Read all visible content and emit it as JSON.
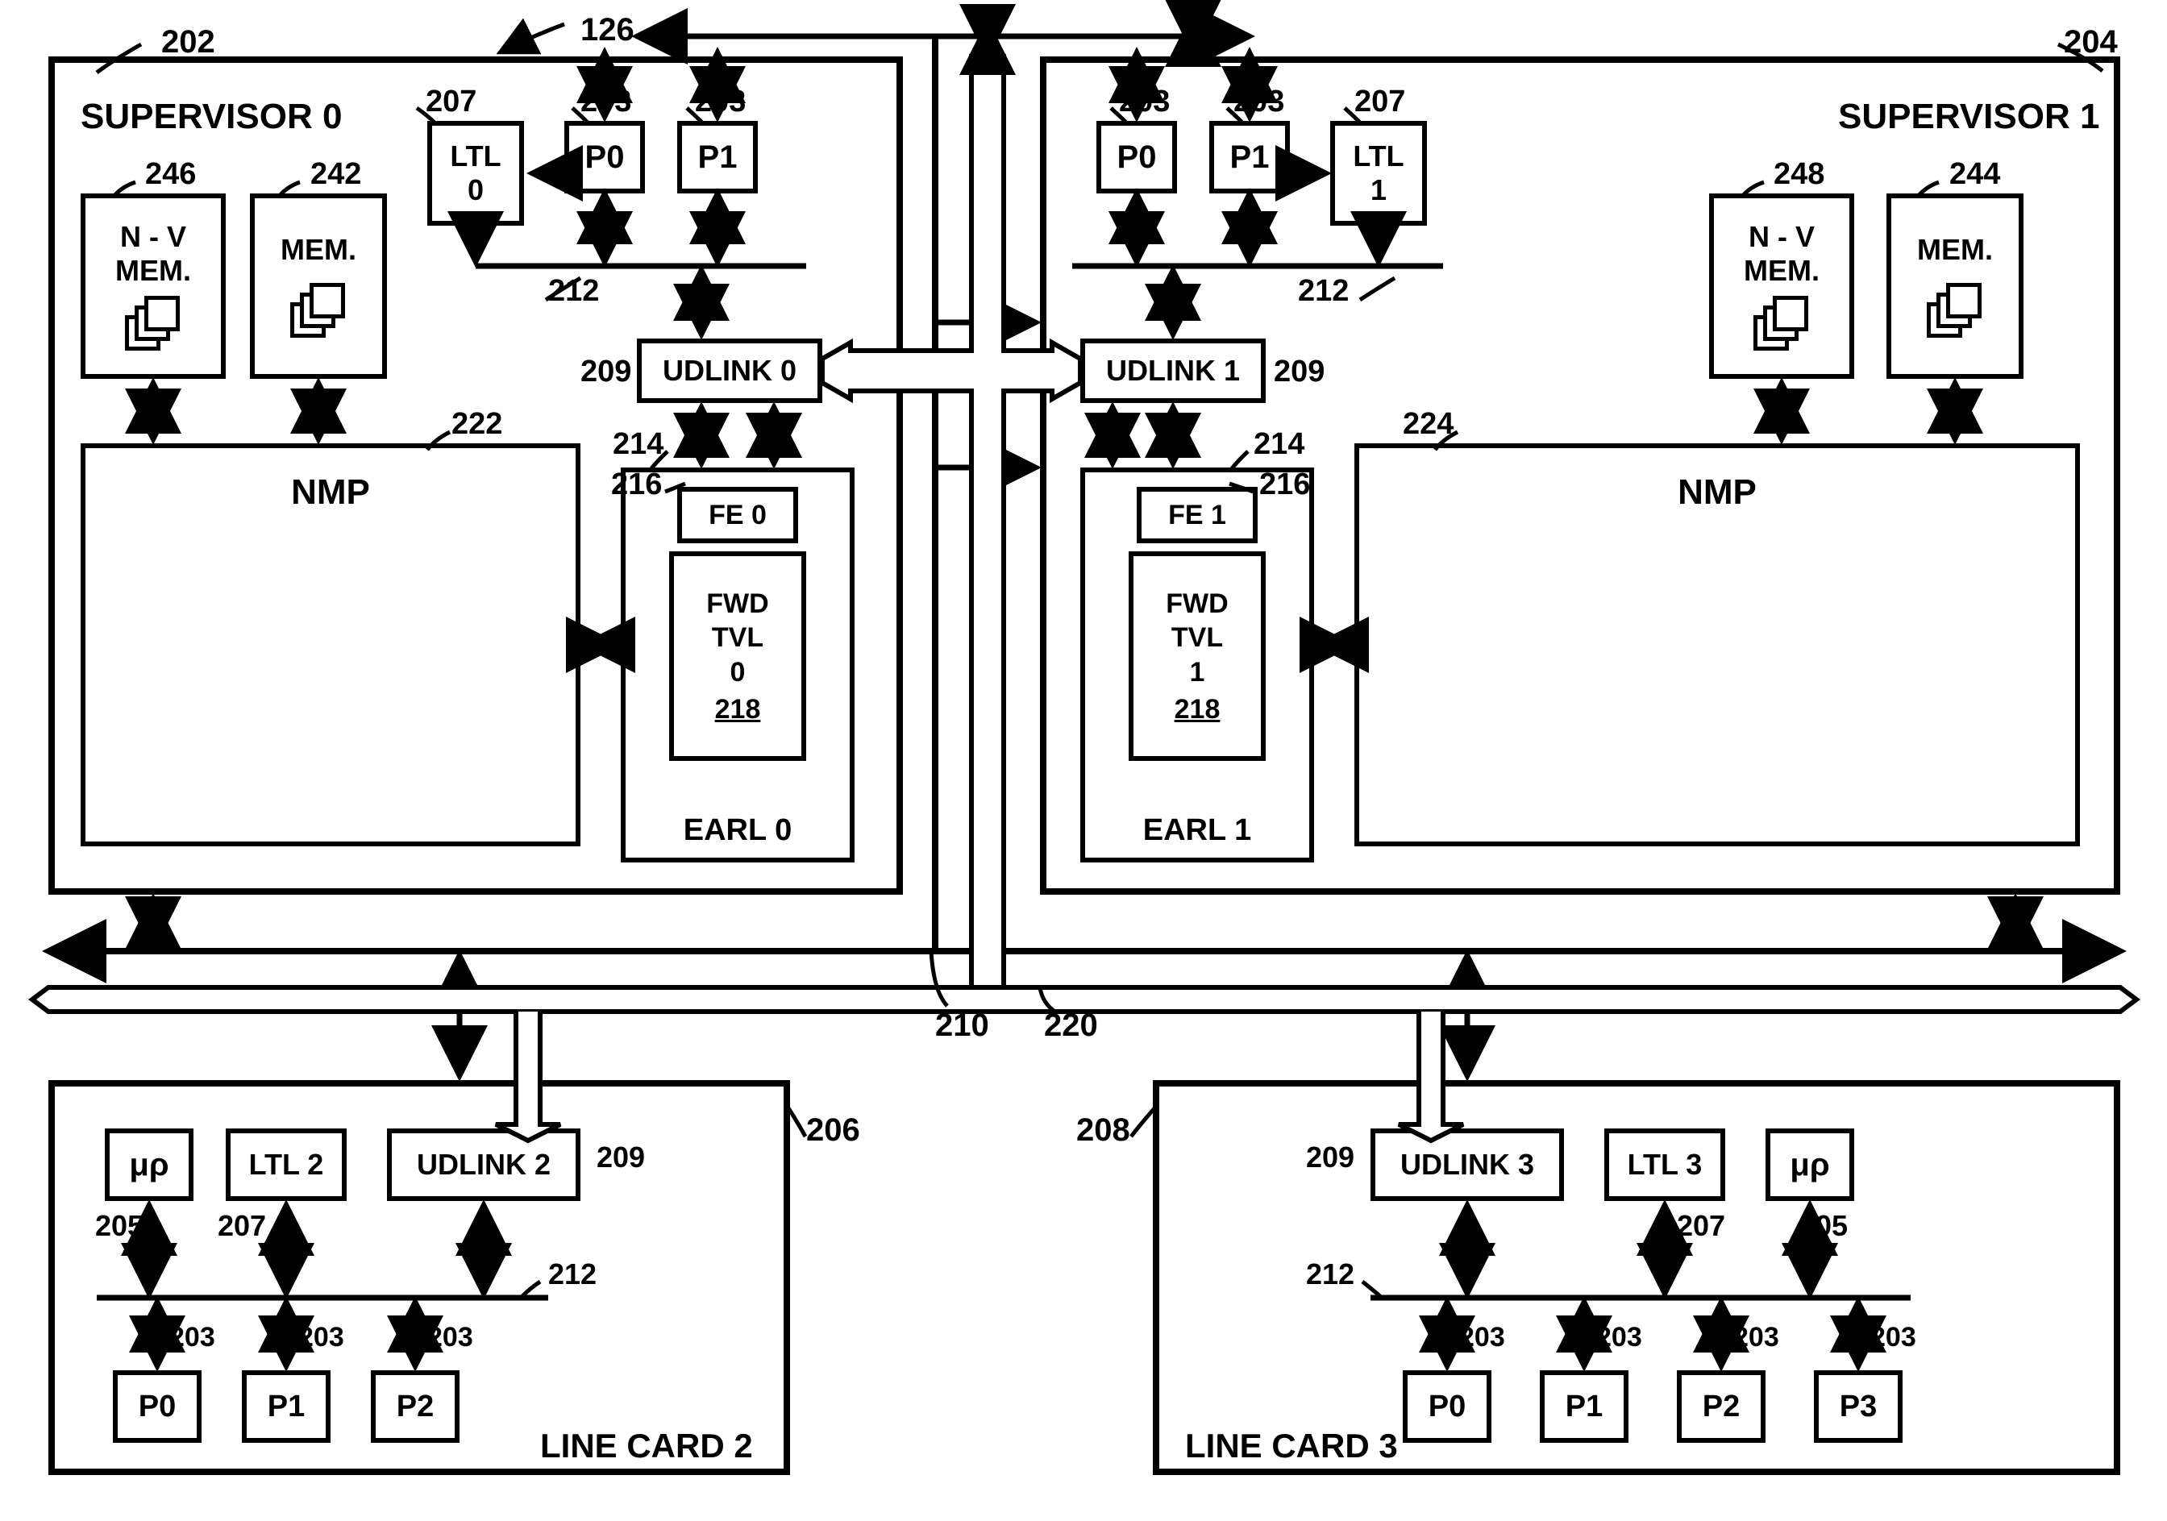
{
  "ref_top": "126",
  "sup0": {
    "title": "SUPERVISOR 0",
    "ref": "202",
    "nvmem": "N - V\nMEM.",
    "nvmem_ref": "246",
    "mem": "MEM.",
    "mem_ref": "242",
    "ltl": "LTL\n0",
    "ltl_ref": "207",
    "p0": "P0",
    "p1": "P1",
    "p_ref": "203",
    "nmp": "NMP",
    "nmp_ref": "222",
    "udlink": "UDLINK 0",
    "udlink_ref": "209",
    "earl": "EARL 0",
    "earl_ref": "214",
    "fe": "FE 0",
    "fe_ref": "216",
    "fwd": "FWD\nTVL\n0",
    "fwd_ref": "218",
    "bus_ref": "212"
  },
  "sup1": {
    "title": "SUPERVISOR 1",
    "ref": "204",
    "nvmem": "N - V\nMEM.",
    "nvmem_ref": "248",
    "mem": "MEM.",
    "mem_ref": "244",
    "ltl": "LTL\n1",
    "ltl_ref": "207",
    "p0": "P0",
    "p1": "P1",
    "p_ref": "203",
    "nmp": "NMP",
    "nmp_ref": "224",
    "udlink": "UDLINK 1",
    "udlink_ref": "209",
    "earl": "EARL 1",
    "earl_ref": "214",
    "fe": "FE 1",
    "fe_ref": "216",
    "fwd": "FWD\nTVL\n1",
    "fwd_ref": "218",
    "bus_ref": "212"
  },
  "mid": {
    "bus_ref": "210",
    "hollow_bus_ref": "220"
  },
  "lc2": {
    "title": "LINE CARD 2",
    "ref": "206",
    "up": "μρ",
    "up_ref": "205",
    "ltl": "LTL 2",
    "ltl_ref": "207",
    "udlink": "UDLINK 2",
    "udlink_ref": "209",
    "p0": "P0",
    "p1": "P1",
    "p2": "P2",
    "p_ref": "203",
    "bus_ref": "212"
  },
  "lc3": {
    "title": "LINE CARD 3",
    "ref": "208",
    "up": "μρ",
    "up_ref": "205",
    "ltl": "LTL 3",
    "ltl_ref": "207",
    "udlink": "UDLINK 3",
    "udlink_ref": "209",
    "p0": "P0",
    "p1": "P1",
    "p2": "P2",
    "p3": "P3",
    "p_ref": "203",
    "bus_ref": "212"
  }
}
